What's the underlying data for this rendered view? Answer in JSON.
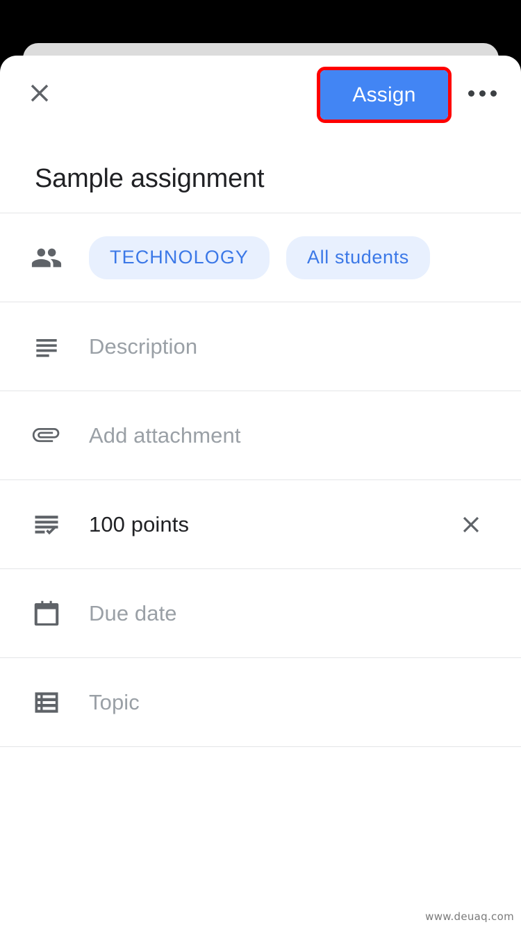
{
  "colors": {
    "accent_blue": "#4285F4",
    "chip_bg": "#E8F0FE",
    "chip_text": "#3B78E7",
    "highlight_border": "#FF0000",
    "icon_gray": "#5F6368",
    "placeholder_gray": "#9AA0A6",
    "text_dark": "#202124",
    "divider": "#E4E5E7",
    "sheet_bg": "#FFFFFF",
    "backdrop": "#000000",
    "behind_card": "#DCDCDC"
  },
  "topbar": {
    "close_icon": "close-icon",
    "assign_label": "Assign",
    "overflow_icon": "more-options-icon"
  },
  "header": {
    "title": "Sample assignment"
  },
  "rows": [
    {
      "name": "audience",
      "icon": "people-icon",
      "type": "chips",
      "chips": [
        {
          "label": "TECHNOLOGY",
          "style": "caps"
        },
        {
          "label": "All students",
          "style": "normal"
        }
      ]
    },
    {
      "name": "description",
      "icon": "subject-icon",
      "type": "label",
      "label": "Description",
      "filled": false
    },
    {
      "name": "attachment",
      "icon": "paperclip-icon",
      "type": "label",
      "label": "Add attachment",
      "filled": false
    },
    {
      "name": "points",
      "icon": "grading-icon",
      "type": "label",
      "label": "100 points",
      "filled": true,
      "clear_icon": "clear-icon"
    },
    {
      "name": "due-date",
      "icon": "calendar-icon",
      "type": "label",
      "label": "Due date",
      "filled": false
    },
    {
      "name": "topic",
      "icon": "list-icon",
      "type": "label",
      "label": "Topic",
      "filled": false
    }
  ],
  "watermark": "www.deuaq.com"
}
